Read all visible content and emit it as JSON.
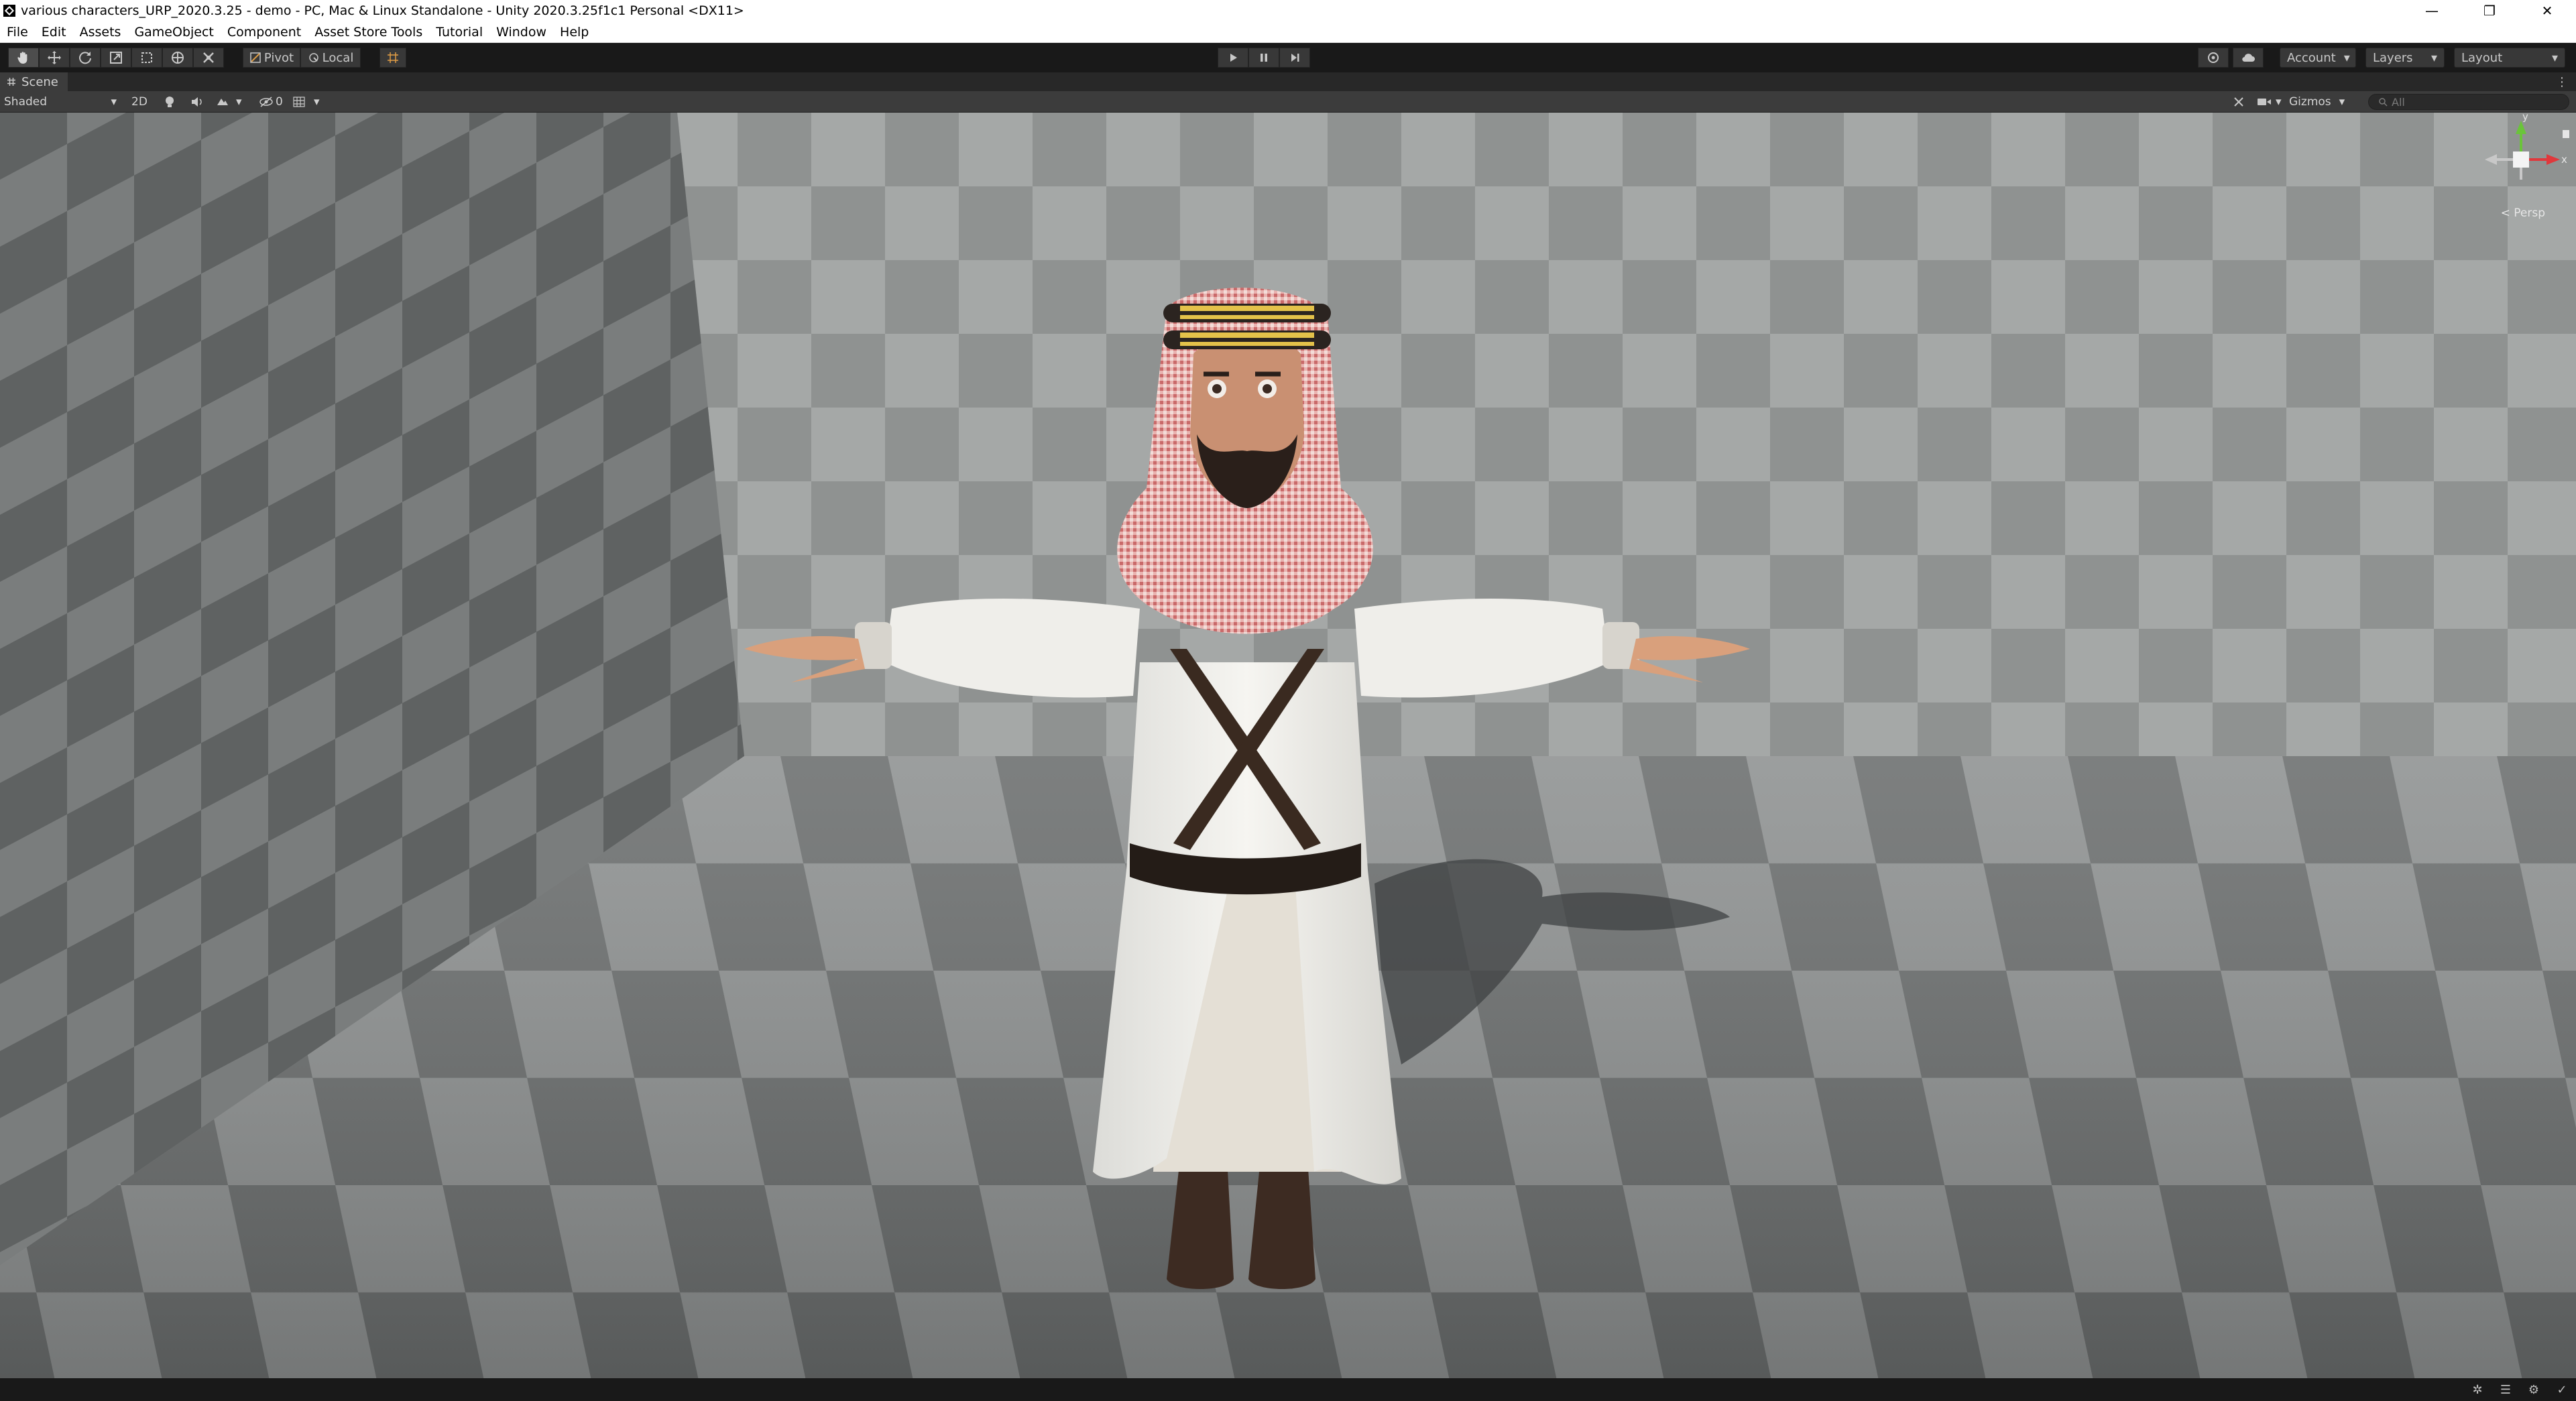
{
  "window": {
    "title": "various characters_URP_2020.3.25 - demo - PC, Mac & Linux Standalone - Unity 2020.3.25f1c1 Personal <DX11>",
    "minimize": "—",
    "maximize": "❐",
    "close": "✕"
  },
  "menu": [
    "File",
    "Edit",
    "Assets",
    "GameObject",
    "Component",
    "Asset Store Tools",
    "Tutorial",
    "Window",
    "Help"
  ],
  "toolbar": {
    "pivot_label": "Pivot",
    "local_label": "Local",
    "account_label": "Account",
    "layers_label": "Layers",
    "layout_label": "Layout",
    "tools": [
      "hand-tool-icon",
      "move-tool-icon",
      "rotate-tool-icon",
      "scale-tool-icon",
      "rect-tool-icon",
      "transform-tool-icon",
      "custom-tool-icon"
    ],
    "play_icons": [
      "play-icon",
      "pause-icon",
      "step-icon"
    ]
  },
  "scene_tab": {
    "label": "Scene"
  },
  "scene_toolbar": {
    "draw_mode": "Shaded",
    "mode_2d": "2D",
    "hidden_count": "0",
    "gizmos_label": "Gizmos",
    "search_placeholder": "All"
  },
  "gizmo": {
    "projection": "< Persp",
    "axis_y": "y",
    "axis_x": "x"
  },
  "colors": {
    "editor_dark": "#191919",
    "panel": "#3c3c3c",
    "viewport_wall": "#9ea1a0",
    "viewport_floor": "#8a8d8d",
    "robe": "#f1f0ec",
    "keffiyeh": "#d98080",
    "strap": "#3a2a20",
    "axis_y": "#6ac43a",
    "axis_x": "#e0383c"
  }
}
